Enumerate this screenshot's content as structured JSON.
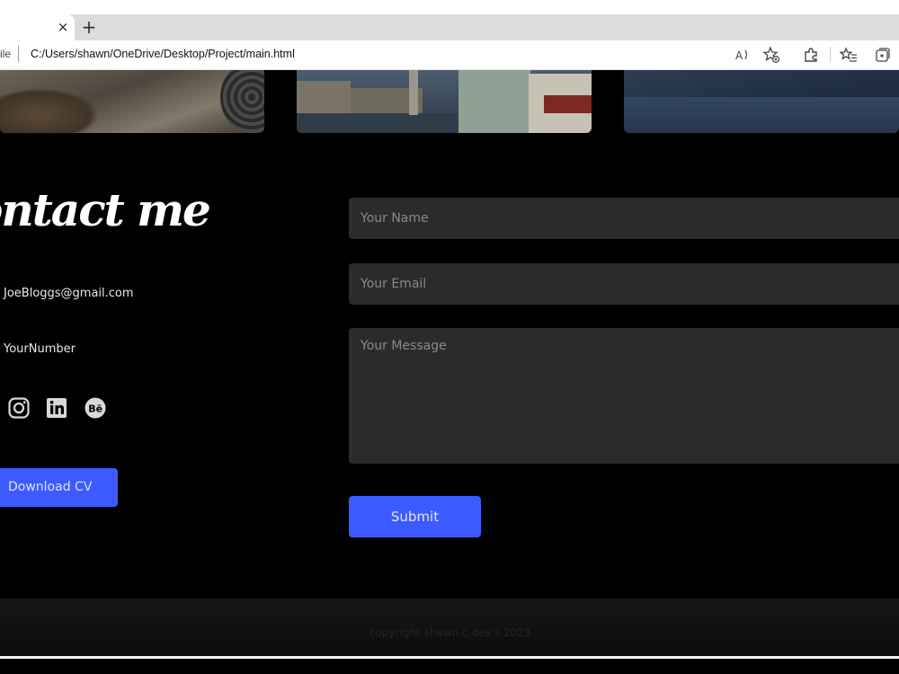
{
  "browser": {
    "tab_close_glyph": "×",
    "new_tab_glyph": "+",
    "address_scheme": "ile",
    "address_url": "C:/Users/shawn/OneDrive/Desktop/Project/main.html",
    "toolbar_icons": [
      "read-aloud-icon",
      "favorite-add-icon",
      "extensions-icon",
      "favorites-icon",
      "collections-icon"
    ]
  },
  "gallery": {
    "images": [
      "rocky-ground-photo",
      "town-square-photo",
      "snowy-landscape-photo"
    ]
  },
  "contact": {
    "title": "ontact me",
    "email": "JoeBloggs@gmail.com",
    "phone": "YourNumber",
    "social_icons": [
      "instagram-icon",
      "linkedin-icon",
      "behance-icon"
    ],
    "download_cv_label": "Download CV"
  },
  "form": {
    "name_placeholder": "Your Name",
    "email_placeholder": "Your Email",
    "message_placeholder": "Your Message",
    "submit_label": "Submit"
  },
  "footer": {
    "copyright": "copyright shawn.c.dev's 2023"
  },
  "colors": {
    "background": "#000000",
    "accent": "#3d5afe",
    "input_bg": "#2b2b2b"
  }
}
